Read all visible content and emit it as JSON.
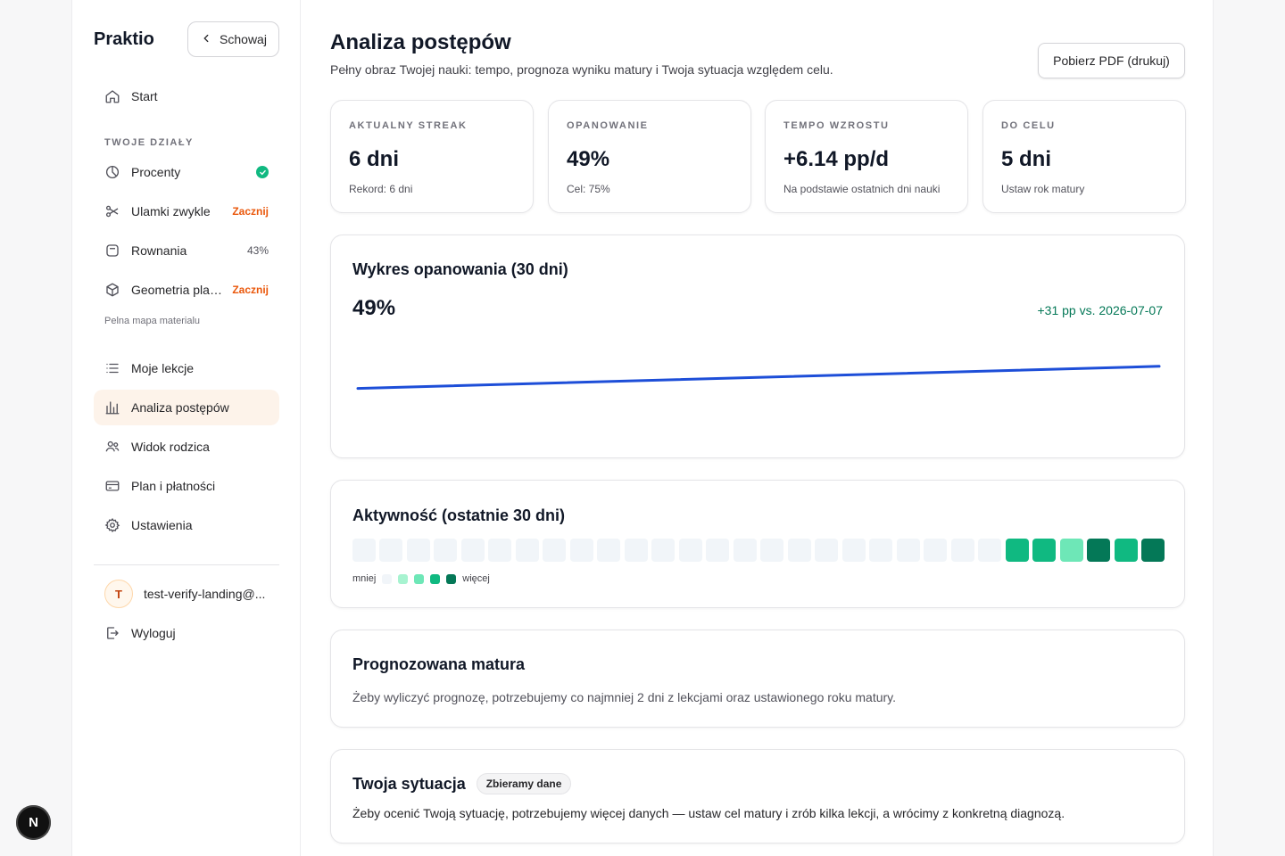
{
  "sidebar": {
    "brand": "Praktio",
    "hide_label": "Schowaj",
    "start_label": "Start",
    "section_title": "TWOJE DZIAŁY",
    "topics": [
      {
        "label": "Procenty",
        "status": "done"
      },
      {
        "label": "Ulamki zwykle",
        "status": "Zacznij"
      },
      {
        "label": "Rownania",
        "status": "43%"
      },
      {
        "label": "Geometria plaska",
        "status": "Zacznij"
      }
    ],
    "map_link": "Pelna mapa materialu",
    "items": [
      {
        "label": "Moje lekcje",
        "icon": "list-icon"
      },
      {
        "label": "Analiza postępów",
        "icon": "bar-chart-icon",
        "active": true
      },
      {
        "label": "Widok rodzica",
        "icon": "users-icon"
      },
      {
        "label": "Plan i płatności",
        "icon": "credit-card-icon"
      },
      {
        "label": "Ustawienia",
        "icon": "gear-icon"
      }
    ],
    "user": {
      "initial": "T",
      "email": "test-verify-landing@..."
    },
    "logout_label": "Wyloguj"
  },
  "header": {
    "title": "Analiza postępów",
    "subtitle": "Pełny obraz Twojej nauki: tempo, prognoza wyniku matury i Twoja sytuacja względem celu.",
    "pdf_button": "Pobierz PDF (drukuj)"
  },
  "kpis": [
    {
      "label": "Aktualny streak",
      "value": "6 dni",
      "sub": "Rekord: 6 dni"
    },
    {
      "label": "Opanowanie",
      "value": "49%",
      "sub": "Cel: 75%"
    },
    {
      "label": "Tempo wzrostu",
      "value": "+6.14 pp/d",
      "sub": "Na podstawie ostatnich dni nauki"
    },
    {
      "label": "Do celu",
      "value": "5 dni",
      "sub": "Ustaw rok matury"
    }
  ],
  "mastery_chart": {
    "title": "Wykres opanowania (30 dni)",
    "current": "49%",
    "delta": "+31 pp vs. 2026-07-07"
  },
  "chart_data": {
    "type": "line",
    "title": "Wykres opanowania (30 dni)",
    "xlabel": "",
    "ylabel": "",
    "x": [
      1,
      30
    ],
    "series": [
      {
        "values": [
          18,
          49
        ]
      }
    ],
    "ylim": [
      0,
      100
    ],
    "grid": false
  },
  "activity": {
    "title": "Aktywność (ostatnie 30 dni)",
    "levels": [
      0,
      0,
      0,
      0,
      0,
      0,
      0,
      0,
      0,
      0,
      0,
      0,
      0,
      0,
      0,
      0,
      0,
      0,
      0,
      0,
      0,
      0,
      0,
      0,
      3,
      3,
      2,
      4,
      3,
      4
    ],
    "colors": [
      "#f1f5f9",
      "#a7f3d0",
      "#6ee7b7",
      "#10b981",
      "#047857"
    ],
    "legend_less": "mniej",
    "legend_more": "więcej"
  },
  "forecast": {
    "title": "Prognozowana matura",
    "text": "Żeby wyliczyć prognozę, potrzebujemy co najmniej 2 dni z lekcjami oraz ustawionego roku matury."
  },
  "situation": {
    "title": "Twoja sytuacja",
    "chip": "Zbieramy dane",
    "text": "Żeby ocenić Twoją sytuację, potrzebujemy więcej danych — ustaw cel matury i zrób kilka lekcji, a wrócimy z konkretną diagnozą."
  },
  "dev_badge": "N",
  "colors": {
    "accent_line": "#1d4ed8",
    "active_bg": "#fdf3ea",
    "start_badge": "#ea580c",
    "delta": "#047857"
  }
}
